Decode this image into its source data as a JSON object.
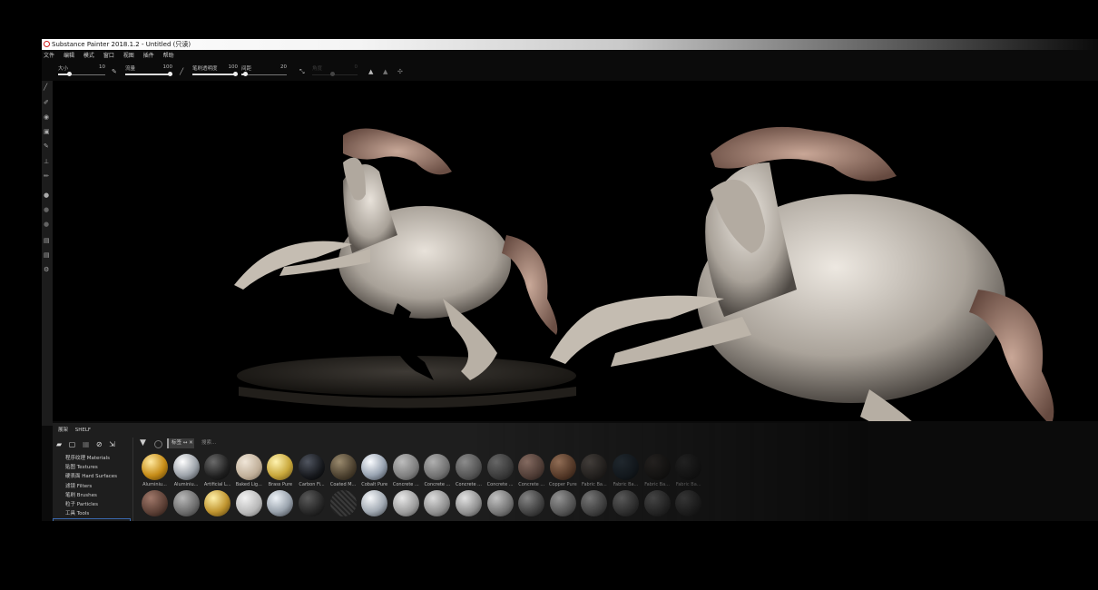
{
  "window": {
    "title": "Substance Painter 2018.1.2 - Untitled (只读)"
  },
  "menu": [
    "文件",
    "编辑",
    "模式",
    "窗口",
    "视图",
    "插件",
    "帮助"
  ],
  "toolbar": {
    "size_label": "大小",
    "size_value": "10",
    "flow_label": "流量",
    "flow_value": "100",
    "opacity_label": "笔刷透明度",
    "opacity_value": "100",
    "spacing_label": "间距",
    "spacing_value": "20",
    "angle_label": "角度",
    "angle_value": "0"
  },
  "colors": {
    "accent_selection": "#3a6ab0",
    "logo": "#d32020"
  },
  "shelf": {
    "tab1": "展架",
    "tab2": "SHELF",
    "search_placeholder": "搜索...",
    "filter_tag": "标签",
    "categories": [
      "程序纹理 Materials",
      "贴图 Textures",
      "硬表面 Hard Surfaces",
      "滤镜 Filters",
      "笔刷 Brushes",
      "粒子 Particles",
      "工具 Tools"
    ],
    "materials_row1": [
      "Aluminiu...",
      "Aluminiu...",
      "Artificial L...",
      "Baked Lig...",
      "Brass Pure",
      "Carbon Fi...",
      "Coated M...",
      "Cobalt Pure",
      "Concrete ...",
      "Concrete ...",
      "Concrete ...",
      "Concrete ...",
      "Concrete ...",
      "Copper Pure",
      "Fabric Ba...",
      "Fabric Ba...",
      "Fabric Ba...",
      "Fabric Ba..."
    ]
  }
}
